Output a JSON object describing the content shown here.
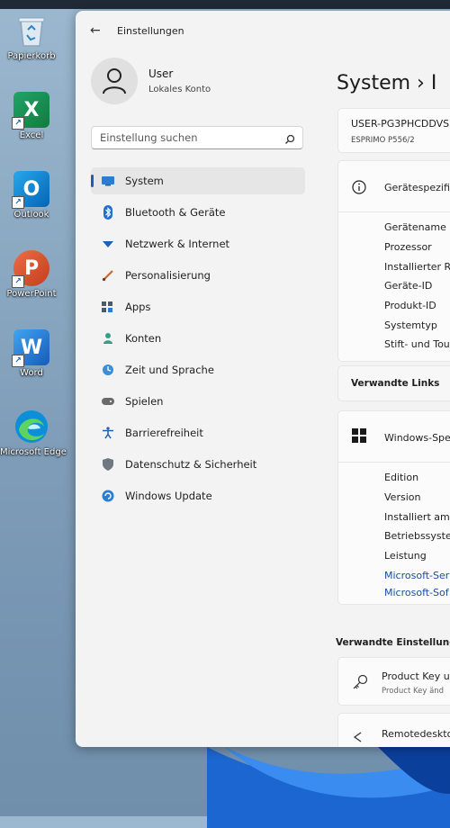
{
  "desktop": {
    "icons": [
      {
        "label": "Papierkorb"
      },
      {
        "label": "Excel",
        "letter": "X"
      },
      {
        "label": "Outlook",
        "letter": "O"
      },
      {
        "label": "PowerPoint",
        "letter": "P"
      },
      {
        "label": "Word",
        "letter": "W"
      },
      {
        "label": "Microsoft Edge"
      }
    ]
  },
  "window": {
    "title": "Einstellungen",
    "back_glyph": "←"
  },
  "user": {
    "name": "User",
    "account_type": "Lokales Konto"
  },
  "search": {
    "placeholder": "Einstellung suchen"
  },
  "nav": {
    "items": [
      {
        "label": "System",
        "icon": "monitor-icon",
        "active": true
      },
      {
        "label": "Bluetooth & Geräte",
        "icon": "bluetooth-icon"
      },
      {
        "label": "Netzwerk & Internet",
        "icon": "wifi-icon"
      },
      {
        "label": "Personalisierung",
        "icon": "brush-icon"
      },
      {
        "label": "Apps",
        "icon": "apps-icon"
      },
      {
        "label": "Konten",
        "icon": "person-icon"
      },
      {
        "label": "Zeit und Sprache",
        "icon": "globe-clock-icon"
      },
      {
        "label": "Spielen",
        "icon": "gamepad-icon"
      },
      {
        "label": "Barrierefreiheit",
        "icon": "accessibility-icon"
      },
      {
        "label": "Datenschutz & Sicherheit",
        "icon": "shield-icon"
      },
      {
        "label": "Windows Update",
        "icon": "update-icon"
      }
    ]
  },
  "main": {
    "breadcrumb": "System  ›  I",
    "device": {
      "name": "USER-PG3PHCDDVS",
      "model": "ESPRIMO P556/2"
    },
    "device_specs": {
      "header": "Gerätespezifi",
      "labels": [
        "Gerätename",
        "Prozessor",
        "Installierter R",
        "Geräte-ID",
        "Produkt-ID",
        "Systemtyp",
        "Stift- und Tou"
      ]
    },
    "related_links": {
      "title": "Verwandte Links"
    },
    "windows_specs": {
      "header": "Windows-Spe",
      "labels": [
        "Edition",
        "Version",
        "Installiert am",
        "Betriebssyster",
        "Leistung"
      ],
      "links": [
        "Microsoft-Ser",
        "Microsoft-Sof"
      ]
    },
    "related_settings": {
      "title": "Verwandte Einstellunge",
      "items": [
        {
          "title": "Product Key u",
          "subtitle": "Product Key änd"
        },
        {
          "title": "Remotedeskto"
        }
      ]
    }
  },
  "colors": {
    "accent": "#1a5fb4",
    "link": "#1a4fa0",
    "window_bg": "#f3f3f3"
  }
}
